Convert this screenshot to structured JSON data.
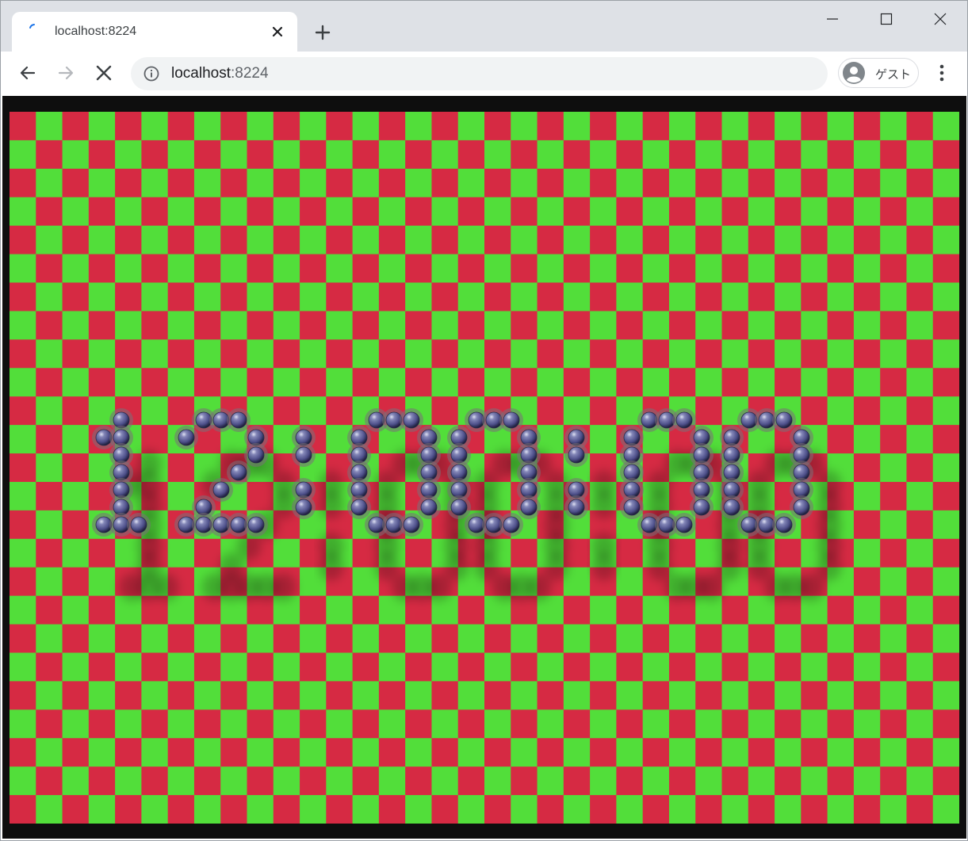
{
  "browser": {
    "tab": {
      "title": "localhost:8224"
    },
    "address": {
      "host": "localhost",
      "port": ":8224"
    },
    "profile": {
      "label": "ゲスト"
    }
  },
  "scene": {
    "clock_text": "12:00:00",
    "floor_colors": [
      "#d62a43",
      "#52de3a"
    ],
    "digit_color": "#4c4e88",
    "border_color": "#0e0e0e"
  }
}
